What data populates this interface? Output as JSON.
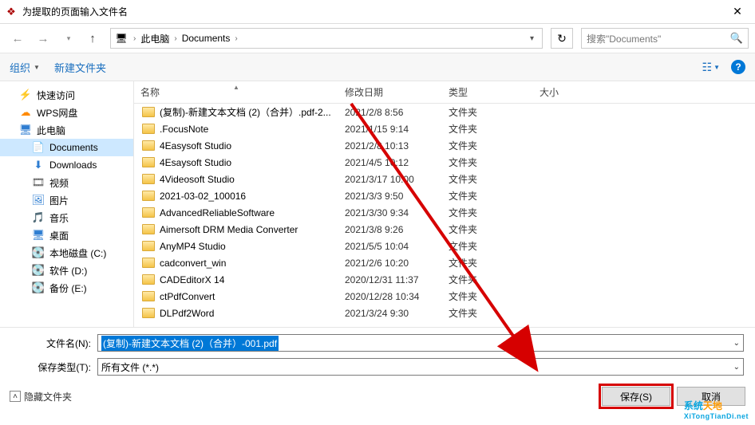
{
  "title": "为提取的页面输入文件名",
  "breadcrumb": {
    "root": "此电脑",
    "folder": "Documents"
  },
  "search_placeholder": "搜索\"Documents\"",
  "toolbar": {
    "organize": "组织",
    "new_folder": "新建文件夹"
  },
  "columns": {
    "name": "名称",
    "date": "修改日期",
    "type": "类型",
    "size": "大小"
  },
  "sidebar": [
    {
      "icon": "⚡",
      "label": "快速访问",
      "color": "#2e7dd1"
    },
    {
      "icon": "☁",
      "label": "WPS网盘",
      "color": "#ff8a00"
    },
    {
      "icon": "🖥",
      "label": "此电脑",
      "color": "#2e7dd1"
    },
    {
      "icon": "📄",
      "label": "Documents",
      "sub": true,
      "selected": true,
      "color": "#2e7dd1"
    },
    {
      "icon": "⬇",
      "label": "Downloads",
      "sub": true,
      "color": "#2e7dd1"
    },
    {
      "icon": "🎞",
      "label": "视频",
      "sub": true,
      "color": "#555"
    },
    {
      "icon": "🖼",
      "label": "图片",
      "sub": true,
      "color": "#2e7dd1"
    },
    {
      "icon": "🎵",
      "label": "音乐",
      "sub": true,
      "color": "#2e7dd1"
    },
    {
      "icon": "🖥",
      "label": "桌面",
      "sub": true,
      "color": "#2e7dd1"
    },
    {
      "icon": "💽",
      "label": "本地磁盘 (C:)",
      "sub": true,
      "color": "#8a8a8a"
    },
    {
      "icon": "💽",
      "label": "软件 (D:)",
      "sub": true,
      "color": "#8a8a8a"
    },
    {
      "icon": "💽",
      "label": "备份 (E:)",
      "sub": true,
      "color": "#8a8a8a"
    }
  ],
  "files": [
    {
      "name": "(复制)-新建文本文档 (2)（合并）.pdf-2...",
      "date": "2021/2/8 8:56",
      "type": "文件夹"
    },
    {
      "name": ".FocusNote",
      "date": "2021/1/15 9:14",
      "type": "文件夹"
    },
    {
      "name": "4Easysoft Studio",
      "date": "2021/2/8 10:13",
      "type": "文件夹"
    },
    {
      "name": "4Esaysoft Studio",
      "date": "2021/4/5 10:12",
      "type": "文件夹"
    },
    {
      "name": "4Videosoft Studio",
      "date": "2021/3/17 10:00",
      "type": "文件夹"
    },
    {
      "name": "2021-03-02_100016",
      "date": "2021/3/3 9:50",
      "type": "文件夹"
    },
    {
      "name": "AdvancedReliableSoftware",
      "date": "2021/3/30 9:34",
      "type": "文件夹"
    },
    {
      "name": "Aimersoft DRM Media Converter",
      "date": "2021/3/8 9:26",
      "type": "文件夹"
    },
    {
      "name": "AnyMP4 Studio",
      "date": "2021/5/5 10:04",
      "type": "文件夹"
    },
    {
      "name": "cadconvert_win",
      "date": "2021/2/6 10:20",
      "type": "文件夹"
    },
    {
      "name": "CADEditorX 14",
      "date": "2020/12/31 11:37",
      "type": "文件夹"
    },
    {
      "name": "ctPdfConvert",
      "date": "2020/12/28 10:34",
      "type": "文件夹"
    },
    {
      "name": "DLPdf2Word",
      "date": "2021/3/24 9:30",
      "type": "文件夹"
    }
  ],
  "filename_label": "文件名(N):",
  "filename_value": "(复制)-新建文本文档 (2)（合并）-001.pdf",
  "filetype_label": "保存类型(T):",
  "filetype_value": "所有文件 (*.*)",
  "hide_folders": "隐藏文件夹",
  "save_btn": "保存(S)",
  "cancel_btn": "取消",
  "watermark": {
    "line1a": "系统",
    "line1b": "天地",
    "line2": "XiTongTianDi.net"
  }
}
